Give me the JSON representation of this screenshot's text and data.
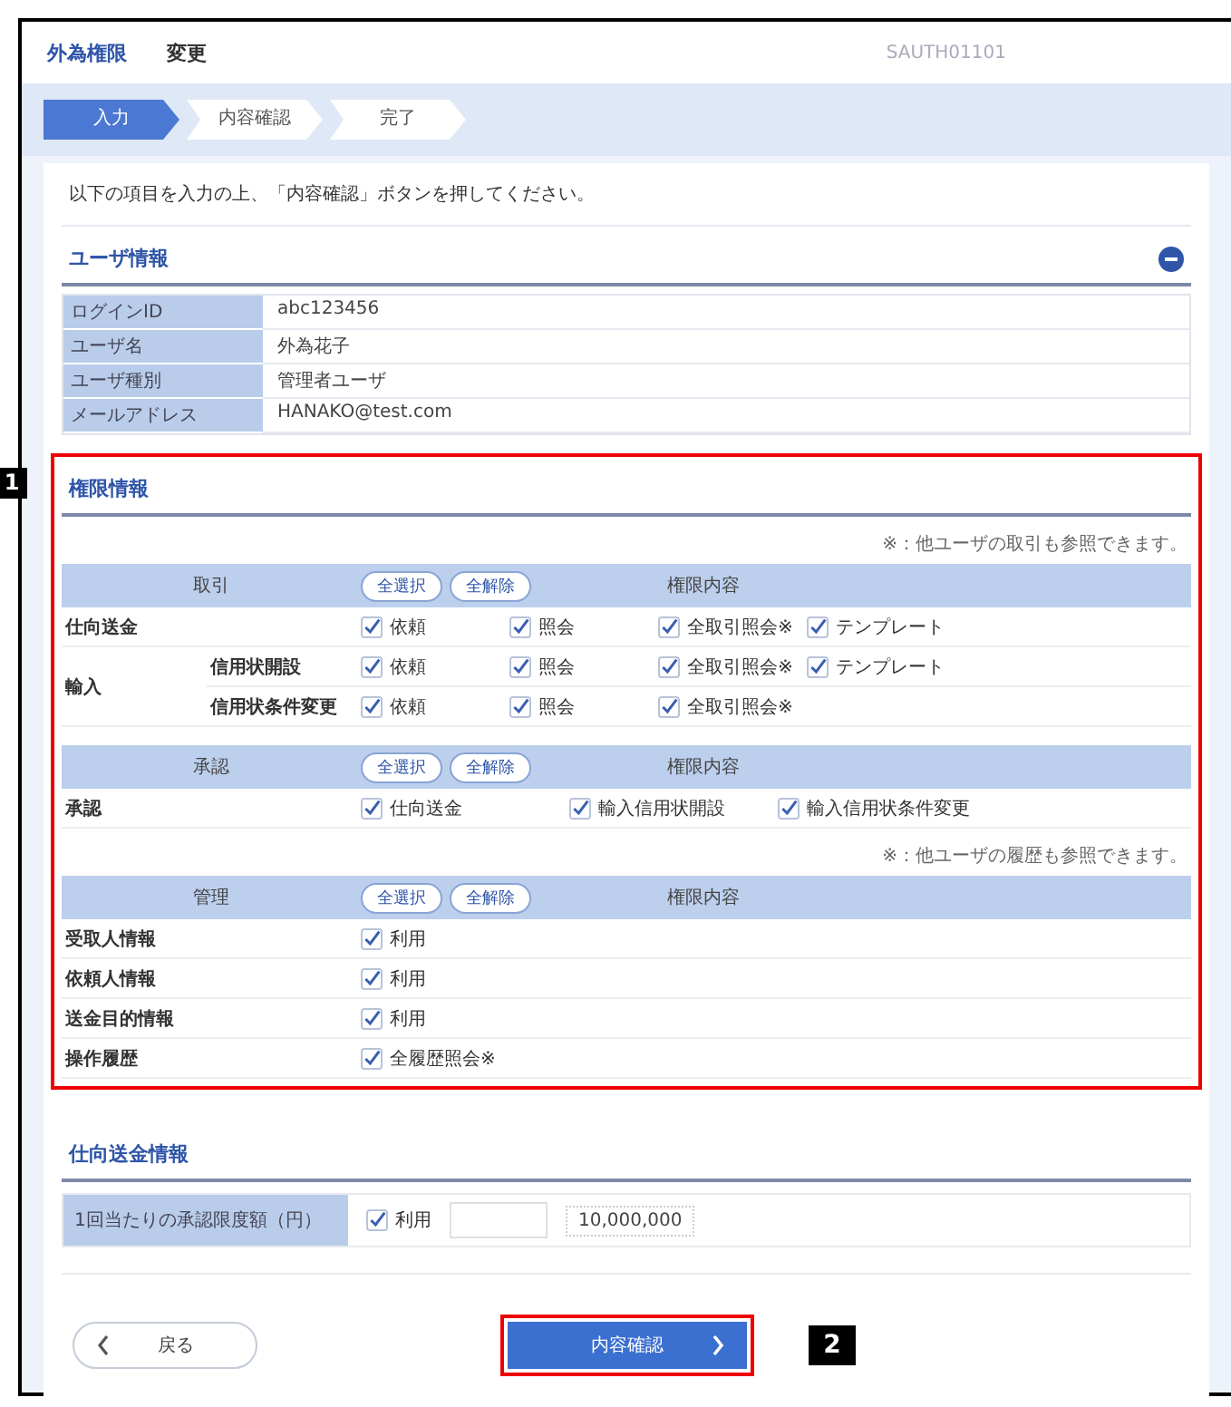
{
  "header": {
    "title": "外為権限",
    "action": "変更",
    "screen_id": "SAUTH01101"
  },
  "steps": [
    {
      "label": "入力",
      "selected": true
    },
    {
      "label": "内容確認",
      "selected": false
    },
    {
      "label": "完了",
      "selected": false
    }
  ],
  "instruction": "以下の項目を入力の上、「内容確認」ボタンを押してください。",
  "user_section": {
    "title": "ユーザ情報",
    "expanded": true,
    "rows": [
      {
        "label": "ログインID",
        "value": "abc123456"
      },
      {
        "label": "ユーザ名",
        "value": "外為花子"
      },
      {
        "label": "ユーザ種別",
        "value": "管理者ユーザ"
      },
      {
        "label": "メールアドレス",
        "value": "HANAKO@test.com"
      }
    ]
  },
  "auth_section": {
    "title": "権限情報",
    "annotation": "1",
    "groups": [
      {
        "kind": "transaction",
        "note": "※：他ユーザの取引も参照できます。",
        "header": {
          "label": "取引",
          "select_all": "全選択",
          "clear_all": "全解除",
          "content": "権限内容"
        },
        "rows": [
          {
            "label": "仕向送金",
            "options": [
              {
                "label": "依頼",
                "checked": true
              },
              {
                "label": "照会",
                "checked": true
              },
              {
                "label": "全取引照会※",
                "checked": true
              },
              {
                "label": "テンプレート",
                "checked": true
              }
            ]
          },
          {
            "label": "輸入",
            "children": [
              {
                "label": "信用状開設",
                "options": [
                  {
                    "label": "依頼",
                    "checked": true
                  },
                  {
                    "label": "照会",
                    "checked": true
                  },
                  {
                    "label": "全取引照会※",
                    "checked": true
                  },
                  {
                    "label": "テンプレート",
                    "checked": true
                  }
                ]
              },
              {
                "label": "信用状条件変更",
                "options": [
                  {
                    "label": "依頼",
                    "checked": true
                  },
                  {
                    "label": "照会",
                    "checked": true
                  },
                  {
                    "label": "全取引照会※",
                    "checked": true
                  }
                ]
              }
            ]
          }
        ]
      },
      {
        "kind": "approval",
        "header": {
          "label": "承認",
          "select_all": "全選択",
          "clear_all": "全解除",
          "content": "権限内容"
        },
        "rows": [
          {
            "label": "承認",
            "options": [
              {
                "label": "仕向送金",
                "checked": true
              },
              {
                "label": "輸入信用状開設",
                "checked": true
              },
              {
                "label": "輸入信用状条件変更",
                "checked": true
              }
            ]
          }
        ]
      },
      {
        "kind": "admin",
        "note": "※：他ユーザの履歴も参照できます。",
        "header": {
          "label": "管理",
          "select_all": "全選択",
          "clear_all": "全解除",
          "content": "権限内容"
        },
        "rows": [
          {
            "label": "受取人情報",
            "options": [
              {
                "label": "利用",
                "checked": true
              }
            ]
          },
          {
            "label": "依頼人情報",
            "options": [
              {
                "label": "利用",
                "checked": true
              }
            ]
          },
          {
            "label": "送金目的情報",
            "options": [
              {
                "label": "利用",
                "checked": true
              }
            ]
          },
          {
            "label": "操作履歴",
            "options": [
              {
                "label": "全履歴照会※",
                "checked": true
              }
            ]
          }
        ]
      }
    ]
  },
  "remittance_section": {
    "title": "仕向送金情報",
    "rows": [
      {
        "label": "1回当たりの承認限度額（円）",
        "checkbox": {
          "label": "利用",
          "checked": true
        },
        "amount": "10,000,000"
      }
    ]
  },
  "buttons": {
    "back": "戻る",
    "confirm": "内容確認",
    "confirm_annotation": "2"
  }
}
